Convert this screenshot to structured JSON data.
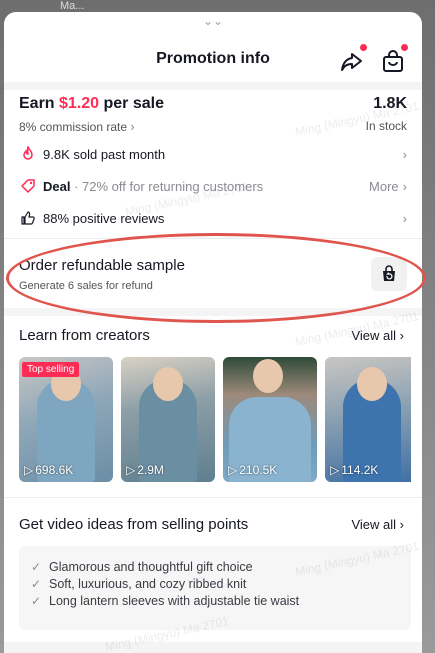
{
  "backdrop_text": "Ma...",
  "header": {
    "grabber": "⌄⌄",
    "title": "Promotion info"
  },
  "earn": {
    "prefix": "Earn ",
    "price": "$1.20",
    "suffix": " per sale",
    "commission": "8% commission rate",
    "stock_amount": "1.8K",
    "stock_label": "In stock"
  },
  "info_rows": [
    {
      "icon": "fire-icon",
      "text": "9.8K sold past month",
      "more": ""
    },
    {
      "icon": "tag-icon",
      "bold": "Deal",
      "text": " · 72% off for returning customers",
      "more": "More"
    },
    {
      "icon": "thumbs-up-icon",
      "text": "88% positive reviews",
      "more": ""
    }
  ],
  "sample": {
    "title": "Order refundable sample",
    "subtitle": "Generate 6 sales for refund"
  },
  "creators": {
    "title": "Learn from creators",
    "view_all": "View all",
    "videos": [
      {
        "views": "698.6K",
        "badge": "Top selling"
      },
      {
        "views": "2.9M",
        "badge": ""
      },
      {
        "views": "210.5K",
        "badge": ""
      },
      {
        "views": "114.2K",
        "badge": ""
      }
    ]
  },
  "ideas": {
    "title": "Get video ideas from selling points",
    "view_all": "View all",
    "items": [
      "Glamorous and thoughtful gift choice",
      "Soft, luxurious, and cozy ribbed knit",
      "Long lantern sleeves with adjustable tie waist"
    ]
  },
  "watermark": "Ming (Mingyu) Ma 2701",
  "colors": {
    "accent": "#fe2c55",
    "annotation": "#e0544e"
  }
}
